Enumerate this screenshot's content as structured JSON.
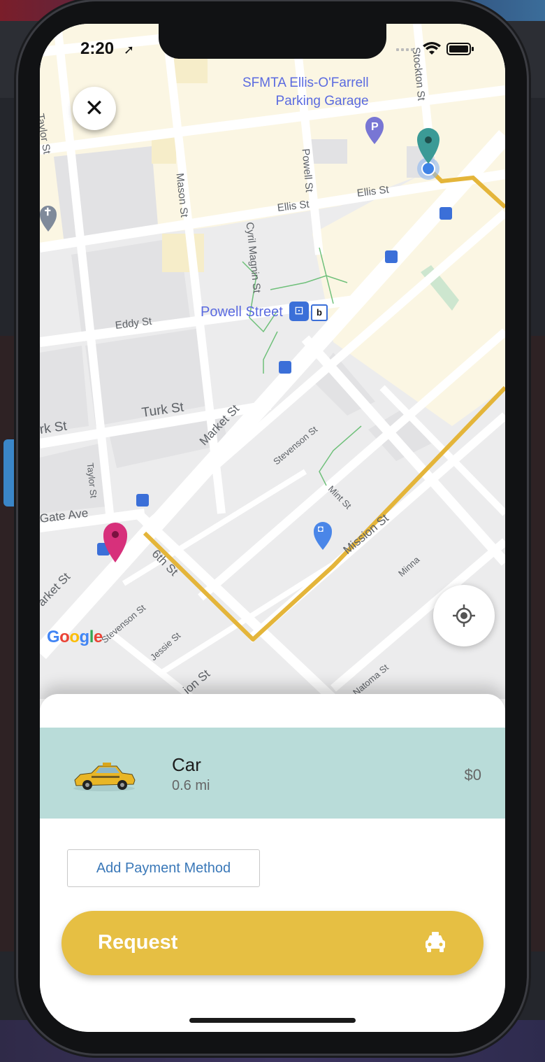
{
  "status_bar": {
    "time": "2:20"
  },
  "map": {
    "poi": {
      "name_line1": "SFMTA Ellis-O'Farrell",
      "name_line2": "Parking Garage"
    },
    "station": "Powell Street",
    "streets": {
      "taylor_top": "Taylor St",
      "mason": "Mason St",
      "powell": "Powell St",
      "stockton": "Stockton St",
      "ellis_1": "Ellis St",
      "ellis_2": "Ellis St",
      "cyril": "Cyril Magnin St",
      "eddy": "Eddy St",
      "turk_1": "Turk St",
      "turk_2": "rk St",
      "market_1": "Market St",
      "market_2": "arket St",
      "stevenson_1": "Stevenson St",
      "stevenson_2": "Stevenson St",
      "taylor_bottom": "Taylor St",
      "gate": "Gate Ave",
      "sixth": "6th St",
      "mint": "Mint St",
      "mission_1": "Mission St",
      "mission_2": "ion St",
      "minna": "Minna",
      "jessie": "Jessie St",
      "natoma": "Natoma St"
    },
    "attribution": "Google",
    "route_color": "#e4b53a",
    "origin_pin_color": "#d7307b",
    "destination_pin_color": "#3b9a96"
  },
  "sheet": {
    "ride": {
      "name": "Car",
      "distance": "0.6 mi",
      "price": "$0"
    },
    "add_payment_label": "Add Payment Method",
    "request_label": "Request",
    "accent_color": "#e6bf43",
    "selected_row_color": "#b9dcd9"
  }
}
